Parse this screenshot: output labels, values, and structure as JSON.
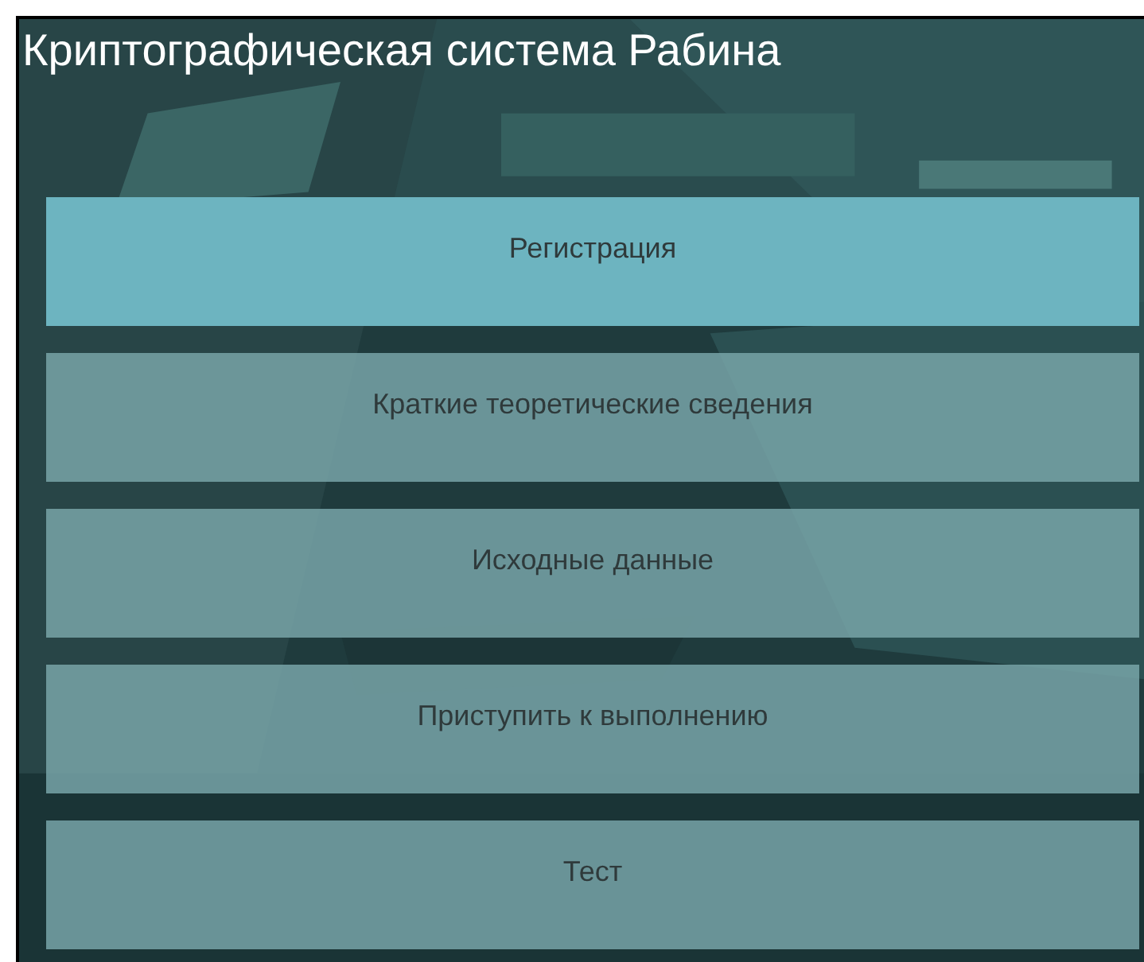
{
  "title": "Криптографическая система Рабина",
  "menu": [
    {
      "label": "Регистрация",
      "selected": true
    },
    {
      "label": "Краткие теоретические сведения",
      "selected": false
    },
    {
      "label": "Исходные данные",
      "selected": false
    },
    {
      "label": "Приступить к выполнению",
      "selected": false
    },
    {
      "label": "Тест",
      "selected": false
    }
  ]
}
